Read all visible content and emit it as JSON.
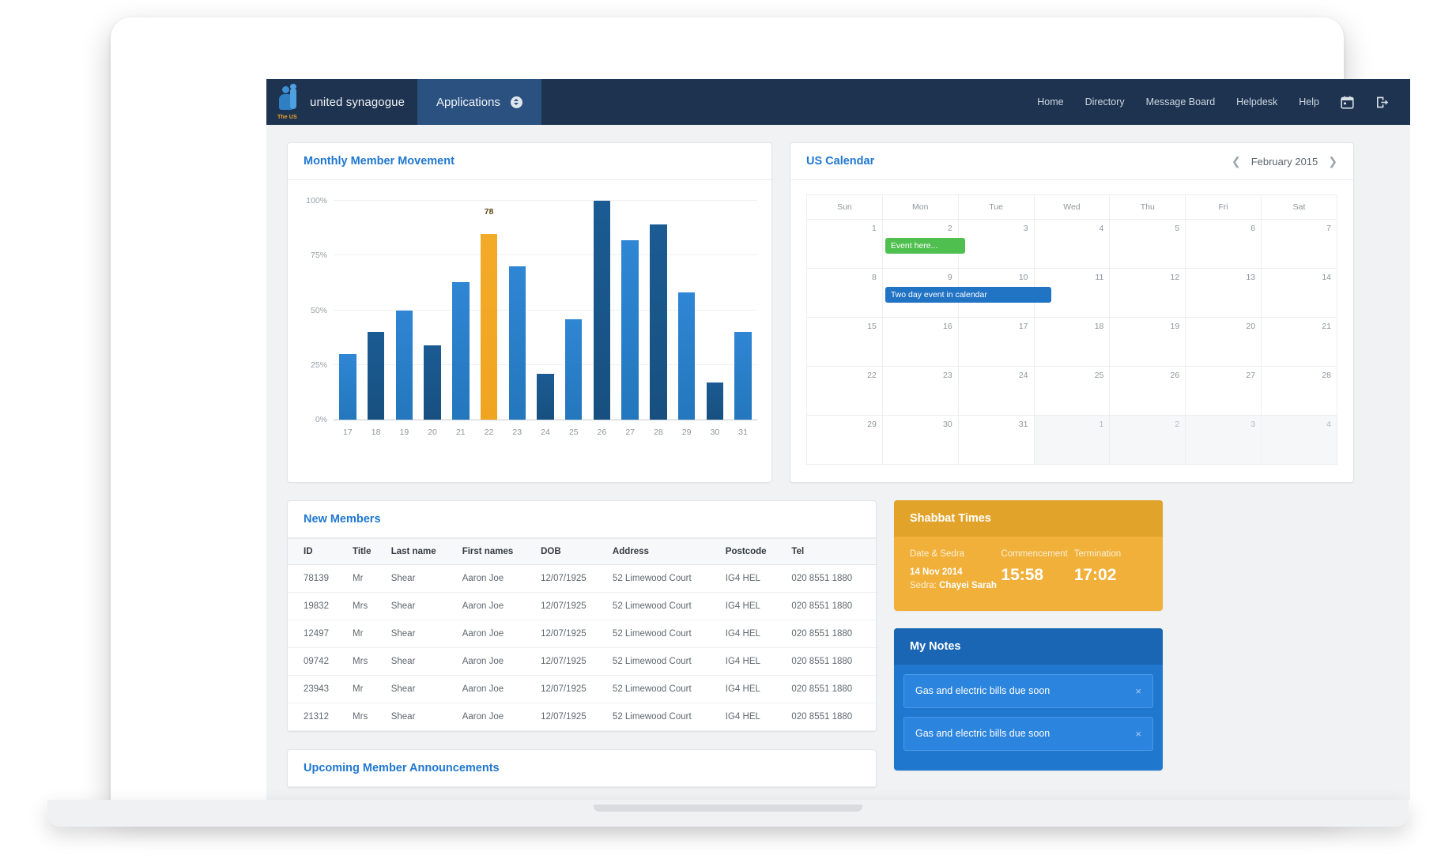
{
  "navbar": {
    "brand": "united synagogue",
    "logo_sub": "The US",
    "applications_label": "Applications",
    "links": [
      "Home",
      "Directory",
      "Message Board",
      "Helpdesk",
      "Help"
    ],
    "calendar_icon": "calendar-icon",
    "logout_icon": "logout-icon",
    "bg_color": "#1e3350",
    "tab_color": "#2a5180"
  },
  "chart_panel": {
    "title": "Monthly Member Movement"
  },
  "chart_data": {
    "type": "bar",
    "title": "Monthly Member Movement",
    "xlabel": "",
    "ylabel": "",
    "ylim": [
      0,
      100
    ],
    "grid": true,
    "ytick_labels": [
      "0%",
      "25%",
      "50%",
      "75%",
      "100%"
    ],
    "ytick_values": [
      0,
      25,
      50,
      75,
      100
    ],
    "categories": [
      "17",
      "18",
      "19",
      "20",
      "21",
      "22",
      "23",
      "24",
      "25",
      "26",
      "27",
      "28",
      "29",
      "30",
      "31"
    ],
    "values": [
      30,
      40,
      50,
      34,
      63,
      85,
      70,
      21,
      46,
      100,
      82,
      89,
      58,
      17,
      40
    ],
    "bar_styles": [
      "light",
      "dark",
      "light",
      "dark",
      "light",
      "highlight",
      "light",
      "dark",
      "light",
      "dark",
      "light",
      "dark",
      "light",
      "dark",
      "light"
    ],
    "highlight_index": 5,
    "data_labels": {
      "22": "78"
    },
    "colors": {
      "light": "#2f86d4",
      "dark": "#1b5b93",
      "highlight": "#f0a824"
    }
  },
  "calendar": {
    "title": "US Calendar",
    "month_label": "February 2015",
    "prev_icon": "chevron-left-icon",
    "next_icon": "chevron-right-icon",
    "weekdays": [
      "Sun",
      "Mon",
      "Tue",
      "Wed",
      "Thu",
      "Fri",
      "Sat"
    ],
    "weeks": [
      [
        {
          "d": "1"
        },
        {
          "d": "2"
        },
        {
          "d": "3"
        },
        {
          "d": "4"
        },
        {
          "d": "5"
        },
        {
          "d": "6"
        },
        {
          "d": "7"
        }
      ],
      [
        {
          "d": "8"
        },
        {
          "d": "9"
        },
        {
          "d": "10"
        },
        {
          "d": "11"
        },
        {
          "d": "12"
        },
        {
          "d": "13"
        },
        {
          "d": "14"
        }
      ],
      [
        {
          "d": "15"
        },
        {
          "d": "16"
        },
        {
          "d": "17"
        },
        {
          "d": "18"
        },
        {
          "d": "19"
        },
        {
          "d": "20"
        },
        {
          "d": "21"
        }
      ],
      [
        {
          "d": "22"
        },
        {
          "d": "23"
        },
        {
          "d": "24"
        },
        {
          "d": "25"
        },
        {
          "d": "26"
        },
        {
          "d": "27"
        },
        {
          "d": "28"
        }
      ],
      [
        {
          "d": "29"
        },
        {
          "d": "30"
        },
        {
          "d": "31"
        },
        {
          "d": "1",
          "o": true
        },
        {
          "d": "2",
          "o": true
        },
        {
          "d": "3",
          "o": true
        },
        {
          "d": "4",
          "o": true
        }
      ]
    ],
    "events": [
      {
        "label": "Event here...",
        "color": "green",
        "week": 0,
        "day": 1,
        "span": 1
      },
      {
        "label": "Two day event in calendar",
        "color": "blue",
        "week": 1,
        "day": 1,
        "span": 2
      }
    ]
  },
  "members": {
    "title": "New Members",
    "columns": [
      "ID",
      "Title",
      "Last name",
      "First names",
      "DOB",
      "Address",
      "Postcode",
      "Tel"
    ],
    "rows": [
      [
        "78139",
        "Mr",
        "Shear",
        "Aaron Joe",
        "12/07/1925",
        "52 Limewood Court",
        "IG4 HEL",
        "020 8551 1880"
      ],
      [
        "19832",
        "Mrs",
        "Shear",
        "Aaron Joe",
        "12/07/1925",
        "52 Limewood Court",
        "IG4 HEL",
        "020 8551 1880"
      ],
      [
        "12497",
        "Mr",
        "Shear",
        "Aaron Joe",
        "12/07/1925",
        "52 Limewood Court",
        "IG4 HEL",
        "020 8551 1880"
      ],
      [
        "09742",
        "Mrs",
        "Shear",
        "Aaron Joe",
        "12/07/1925",
        "52 Limewood Court",
        "IG4 HEL",
        "020 8551 1880"
      ],
      [
        "23943",
        "Mr",
        "Shear",
        "Aaron Joe",
        "12/07/1925",
        "52 Limewood Court",
        "IG4 HEL",
        "020 8551 1880"
      ],
      [
        "21312",
        "Mrs",
        "Shear",
        "Aaron Joe",
        "12/07/1925",
        "52 Limewood Court",
        "IG4 HEL",
        "020 8551 1880"
      ]
    ]
  },
  "shabbat": {
    "title": "Shabbat Times",
    "col1_label": "Date & Sedra",
    "col2_label": "Commencement",
    "col3_label": "Termination",
    "date": "14 Nov 2014",
    "sedra_prefix": "Sedra: ",
    "sedra_name": "Chayei Sarah",
    "commencement": "15:58",
    "termination": "17:02",
    "bg_color": "#f0b03a"
  },
  "notes": {
    "title": "My Notes",
    "items": [
      {
        "text": "Gas and electric bills due soon",
        "close": "×"
      },
      {
        "text": "Gas and electric bills due soon",
        "close": "×"
      }
    ],
    "bg_color": "#2077ce"
  },
  "announcements": {
    "title": "Upcoming Member Announcements"
  }
}
